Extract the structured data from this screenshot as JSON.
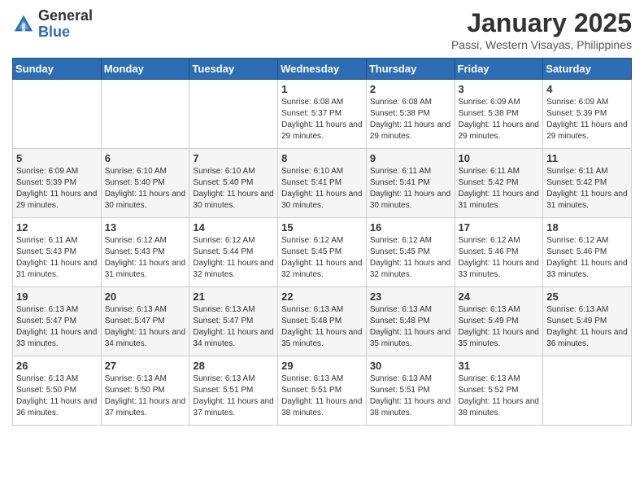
{
  "logo": {
    "general": "General",
    "blue": "Blue"
  },
  "header": {
    "month": "January 2025",
    "location": "Passi, Western Visayas, Philippines"
  },
  "weekdays": [
    "Sunday",
    "Monday",
    "Tuesday",
    "Wednesday",
    "Thursday",
    "Friday",
    "Saturday"
  ],
  "weeks": [
    [
      null,
      null,
      null,
      {
        "day": 1,
        "sunrise": "6:08 AM",
        "sunset": "5:37 PM",
        "daylight": "11 hours and 29 minutes."
      },
      {
        "day": 2,
        "sunrise": "6:08 AM",
        "sunset": "5:38 PM",
        "daylight": "11 hours and 29 minutes."
      },
      {
        "day": 3,
        "sunrise": "6:09 AM",
        "sunset": "5:38 PM",
        "daylight": "11 hours and 29 minutes."
      },
      {
        "day": 4,
        "sunrise": "6:09 AM",
        "sunset": "5:39 PM",
        "daylight": "11 hours and 29 minutes."
      }
    ],
    [
      {
        "day": 5,
        "sunrise": "6:09 AM",
        "sunset": "5:39 PM",
        "daylight": "11 hours and 29 minutes."
      },
      {
        "day": 6,
        "sunrise": "6:10 AM",
        "sunset": "5:40 PM",
        "daylight": "11 hours and 30 minutes."
      },
      {
        "day": 7,
        "sunrise": "6:10 AM",
        "sunset": "5:40 PM",
        "daylight": "11 hours and 30 minutes."
      },
      {
        "day": 8,
        "sunrise": "6:10 AM",
        "sunset": "5:41 PM",
        "daylight": "11 hours and 30 minutes."
      },
      {
        "day": 9,
        "sunrise": "6:11 AM",
        "sunset": "5:41 PM",
        "daylight": "11 hours and 30 minutes."
      },
      {
        "day": 10,
        "sunrise": "6:11 AM",
        "sunset": "5:42 PM",
        "daylight": "11 hours and 31 minutes."
      },
      {
        "day": 11,
        "sunrise": "6:11 AM",
        "sunset": "5:42 PM",
        "daylight": "11 hours and 31 minutes."
      }
    ],
    [
      {
        "day": 12,
        "sunrise": "6:11 AM",
        "sunset": "5:43 PM",
        "daylight": "11 hours and 31 minutes."
      },
      {
        "day": 13,
        "sunrise": "6:12 AM",
        "sunset": "5:43 PM",
        "daylight": "11 hours and 31 minutes."
      },
      {
        "day": 14,
        "sunrise": "6:12 AM",
        "sunset": "5:44 PM",
        "daylight": "11 hours and 32 minutes."
      },
      {
        "day": 15,
        "sunrise": "6:12 AM",
        "sunset": "5:45 PM",
        "daylight": "11 hours and 32 minutes."
      },
      {
        "day": 16,
        "sunrise": "6:12 AM",
        "sunset": "5:45 PM",
        "daylight": "11 hours and 32 minutes."
      },
      {
        "day": 17,
        "sunrise": "6:12 AM",
        "sunset": "5:46 PM",
        "daylight": "11 hours and 33 minutes."
      },
      {
        "day": 18,
        "sunrise": "6:12 AM",
        "sunset": "5:46 PM",
        "daylight": "11 hours and 33 minutes."
      }
    ],
    [
      {
        "day": 19,
        "sunrise": "6:13 AM",
        "sunset": "5:47 PM",
        "daylight": "11 hours and 33 minutes."
      },
      {
        "day": 20,
        "sunrise": "6:13 AM",
        "sunset": "5:47 PM",
        "daylight": "11 hours and 34 minutes."
      },
      {
        "day": 21,
        "sunrise": "6:13 AM",
        "sunset": "5:47 PM",
        "daylight": "11 hours and 34 minutes."
      },
      {
        "day": 22,
        "sunrise": "6:13 AM",
        "sunset": "5:48 PM",
        "daylight": "11 hours and 35 minutes."
      },
      {
        "day": 23,
        "sunrise": "6:13 AM",
        "sunset": "5:48 PM",
        "daylight": "11 hours and 35 minutes."
      },
      {
        "day": 24,
        "sunrise": "6:13 AM",
        "sunset": "5:49 PM",
        "daylight": "11 hours and 35 minutes."
      },
      {
        "day": 25,
        "sunrise": "6:13 AM",
        "sunset": "5:49 PM",
        "daylight": "11 hours and 36 minutes."
      }
    ],
    [
      {
        "day": 26,
        "sunrise": "6:13 AM",
        "sunset": "5:50 PM",
        "daylight": "11 hours and 36 minutes."
      },
      {
        "day": 27,
        "sunrise": "6:13 AM",
        "sunset": "5:50 PM",
        "daylight": "11 hours and 37 minutes."
      },
      {
        "day": 28,
        "sunrise": "6:13 AM",
        "sunset": "5:51 PM",
        "daylight": "11 hours and 37 minutes."
      },
      {
        "day": 29,
        "sunrise": "6:13 AM",
        "sunset": "5:51 PM",
        "daylight": "11 hours and 38 minutes."
      },
      {
        "day": 30,
        "sunrise": "6:13 AM",
        "sunset": "5:51 PM",
        "daylight": "11 hours and 38 minutes."
      },
      {
        "day": 31,
        "sunrise": "6:13 AM",
        "sunset": "5:52 PM",
        "daylight": "11 hours and 38 minutes."
      },
      null
    ]
  ],
  "labels": {
    "sunrise": "Sunrise:",
    "sunset": "Sunset:",
    "daylight": "Daylight:"
  },
  "colors": {
    "header_bg": "#2e6db4",
    "accent": "#2e6db4"
  }
}
